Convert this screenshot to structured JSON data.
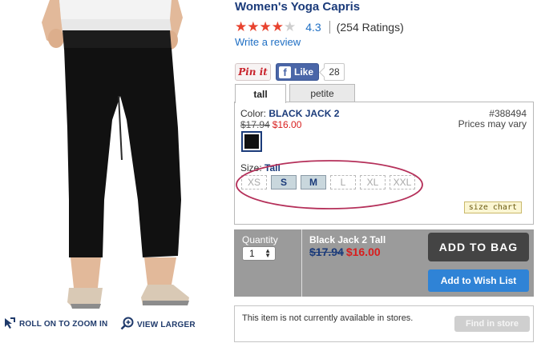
{
  "product": {
    "title": "Women's Yoga Capris",
    "rating_value": "4.3",
    "rating_stars": 4.3,
    "rating_count": "(254 Ratings)",
    "write_review": "Write a review"
  },
  "social": {
    "pin_label": "Pin it",
    "fb_icon": "f",
    "fb_label": "Like",
    "fb_count": "28"
  },
  "tabs": [
    {
      "label": "tall",
      "active": true
    },
    {
      "label": "petite",
      "active": false
    }
  ],
  "variant": {
    "color_label": "Color:",
    "color_value": "BLACK JACK 2",
    "item_number": "#388494",
    "prices_may_vary": "Prices may vary",
    "regular_price": "$17.94",
    "sale_price": "$16.00",
    "swatch_color": "#111111",
    "size_label": "Size:",
    "size_value": "Tall",
    "sizes": [
      {
        "label": "XS",
        "available": false
      },
      {
        "label": "S",
        "available": true
      },
      {
        "label": "M",
        "available": true
      },
      {
        "label": "L",
        "available": false
      },
      {
        "label": "XL",
        "available": false
      },
      {
        "label": "XXL",
        "available": false
      }
    ],
    "size_chart": "size chart"
  },
  "buy": {
    "quantity_label": "Quantity",
    "quantity_value": "1",
    "item_name": "Black Jack 2 Tall",
    "regular_price": "$17.94",
    "sale_price": "$16.00",
    "add_to_bag": "ADD TO BAG",
    "add_to_wishlist": "Add to Wish List"
  },
  "store": {
    "message": "This item is not currently available in stores.",
    "find_button": "Find in store"
  },
  "image_links": {
    "roll_zoom": "ROLL ON TO ZOOM IN",
    "view_larger": "VIEW LARGER"
  },
  "colors": {
    "brand_navy": "#1b3b7a",
    "link_blue": "#1f6fc4",
    "sale_red": "#d81e1e",
    "star_red": "#e8432f",
    "highlight_ellipse": "#b5305a"
  }
}
